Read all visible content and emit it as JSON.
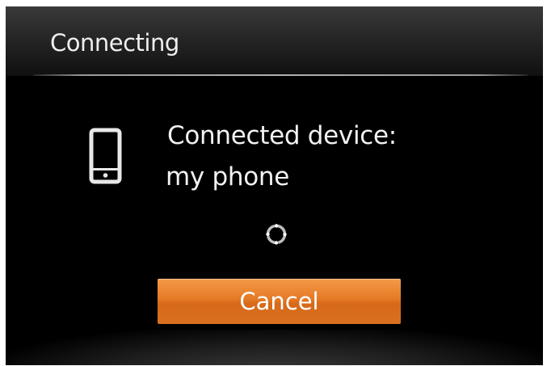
{
  "header": {
    "title": "Connecting"
  },
  "device": {
    "icon": "smartphone-icon",
    "label": "Connected device:",
    "name": "my phone"
  },
  "status": {
    "icon": "loading-spinner-icon"
  },
  "actions": {
    "cancel_label": "Cancel"
  },
  "colors": {
    "background": "#000000",
    "text": "#f2f2f2",
    "accent": "#e57a25"
  }
}
